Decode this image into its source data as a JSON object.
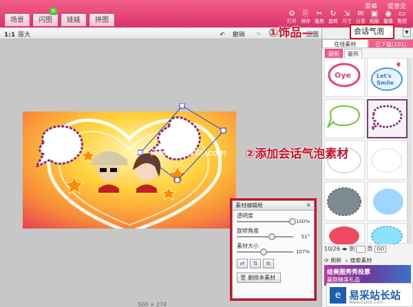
{
  "header": {
    "menu": [
      "菜单",
      "提意见"
    ],
    "tabs": [
      {
        "label": "场景",
        "active": false
      },
      {
        "label": "闪图",
        "active": false,
        "badge": "N"
      },
      {
        "label": "娃娃",
        "active": false
      },
      {
        "label": "拼图",
        "active": false
      }
    ],
    "tools": [
      {
        "icon": "gear-icon",
        "glyph": "⚙",
        "label": "打开"
      },
      {
        "icon": "save-icon",
        "glyph": "⎘",
        "label": "保存"
      },
      {
        "icon": "crop-icon",
        "glyph": "✂",
        "label": "裁剪"
      },
      {
        "icon": "rotate-icon",
        "glyph": "↻",
        "label": "旋转"
      },
      {
        "icon": "resize-icon",
        "glyph": "⇲",
        "label": "尺寸"
      },
      {
        "icon": "share-icon",
        "glyph": "✉",
        "label": "分享"
      },
      {
        "icon": "album-icon",
        "glyph": "▣",
        "label": "相册"
      },
      {
        "icon": "camera-icon",
        "glyph": "◉",
        "label": "摄像头"
      },
      {
        "icon": "view-icon",
        "glyph": "▭",
        "label": "看图"
      }
    ]
  },
  "toolbar": {
    "zoom_ratio": "1:1",
    "zoom_label": "原大",
    "undo": "撤销",
    "redo": "重做",
    "original": "原图"
  },
  "annotations": {
    "step1_text": "①饰品—",
    "step1_item": "会话气泡",
    "step2_text": "②添加会话气泡素材"
  },
  "right_panel": {
    "tabs": [
      "在线素材",
      "已下载(101)"
    ],
    "subtabs": [
      "最新",
      "最热"
    ],
    "pager_text": "10/26",
    "pager_to": "到",
    "pager_page": "页",
    "pager_go": "GO",
    "refresh": "刷新",
    "find": "搜索素材",
    "banner_title": "给美图秀秀投票",
    "banner_sub": "赢取精美礼品"
  },
  "edit_window": {
    "title": "素材编辑框",
    "sliders": [
      {
        "label": "透明度",
        "value": "100%",
        "fraction": 1.0
      },
      {
        "label": "旋转角度",
        "value": "51°",
        "fraction": 0.6
      },
      {
        "label": "素材大小",
        "value": "107%",
        "fraction": 0.45
      }
    ],
    "delete_label": "删除本素材"
  },
  "canvas": {
    "dimensions": "500 × 274",
    "watermark": "www.DuoTe.com"
  },
  "footer_watermark": {
    "name": "易采站长站",
    "url": "Www.Easck.Com"
  },
  "colors": {
    "brand": "#e0406f",
    "annotation": "#c8122a"
  }
}
